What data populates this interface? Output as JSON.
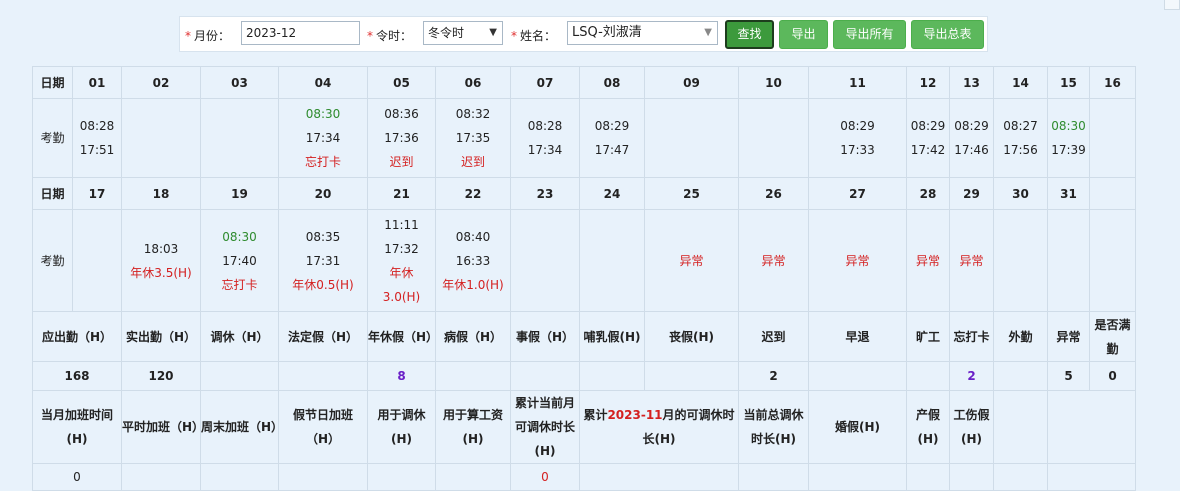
{
  "toolbar": {
    "month_label": "月份：",
    "month_value": "2023-12",
    "season_label": "令时：",
    "season_value": "冬令时",
    "name_label": "姓名：",
    "name_value": "LSQ-刘淑清",
    "search_btn": "查找",
    "export_btn": "导出",
    "export_all_btn": "导出所有",
    "export_summary_btn": "导出总表"
  },
  "colors": {
    "button_green": "#5cb85c",
    "abnormal_red": "#d42020",
    "ontime_green": "#2e8b2e",
    "count_purple": "#6a1fc7"
  },
  "grid": {
    "date_label": "日期",
    "attendance_label": "考勤",
    "week1": {
      "days": [
        "01",
        "02",
        "03",
        "04",
        "05",
        "06",
        "07",
        "08",
        "09",
        "10",
        "11",
        "12",
        "13",
        "14",
        "15",
        "16"
      ],
      "cells": [
        [
          "08:28",
          "17:51"
        ],
        [],
        [],
        [
          "08:30",
          "17:34",
          "忘打卡"
        ],
        [
          "08:36",
          "17:36",
          "迟到"
        ],
        [
          "08:32",
          "17:35",
          "迟到"
        ],
        [
          "08:28",
          "17:34"
        ],
        [
          "08:29",
          "17:47"
        ],
        [],
        [],
        [
          "08:29",
          "17:33"
        ],
        [
          "08:29",
          "17:42"
        ],
        [
          "08:29",
          "17:46"
        ],
        [
          "08:27",
          "17:56"
        ],
        [
          "08:30",
          "17:39"
        ],
        []
      ]
    },
    "week2": {
      "days": [
        "17",
        "18",
        "19",
        "20",
        "21",
        "22",
        "23",
        "24",
        "25",
        "26",
        "27",
        "28",
        "29",
        "30",
        "31",
        ""
      ],
      "cells": [
        [],
        [
          "18:03",
          "年休3.5(H)"
        ],
        [
          "08:30",
          "17:40",
          "忘打卡"
        ],
        [
          "08:35",
          "17:31",
          "年休0.5(H)"
        ],
        [
          "11:11",
          "17:32",
          "年休",
          "3.0(H)"
        ],
        [
          "08:40",
          "16:33",
          "年休1.0(H)"
        ],
        [],
        [],
        [
          "异常"
        ],
        [
          "异常"
        ],
        [
          "异常"
        ],
        [
          "异常"
        ],
        [
          "异常"
        ],
        [],
        [],
        []
      ]
    },
    "summary_headers": [
      "应出勤（H）",
      "实出勤（H）",
      "调休（H）",
      "法定假（H）",
      "年休假（H）",
      "病假（H）",
      "事假（H）",
      "哺乳假(H)",
      "丧假(H)",
      "迟到",
      "早退",
      "旷工",
      "忘打卡",
      "外勤",
      "异常",
      "是否满勤"
    ],
    "summary_values": [
      "168",
      "120",
      "",
      "",
      "8",
      "",
      "",
      "",
      "",
      "2",
      "",
      "",
      "2",
      "",
      "5",
      "0"
    ],
    "overtime_headers": [
      "当月加班时间(H)",
      "平时加班（H）",
      "周末加班（H）",
      "假节日加班（H）",
      "用于调休(H)",
      "用于算工资(H)",
      "累计当前月可调休时长(H)",
      "累计{month}月的可调休时长(H)",
      "当前总调休时长(H)",
      "婚假(H)",
      "产假(H)",
      "工伤假(H)",
      "",
      ""
    ],
    "overtime_highlight_month": "2023-11",
    "overtime_header_prefix": "累计",
    "overtime_header_suffix": "月的可调休时长(H)",
    "overtime_values": [
      "0",
      "",
      "",
      "",
      "",
      "",
      "0",
      "",
      "",
      "",
      "",
      "",
      "",
      ""
    ]
  }
}
